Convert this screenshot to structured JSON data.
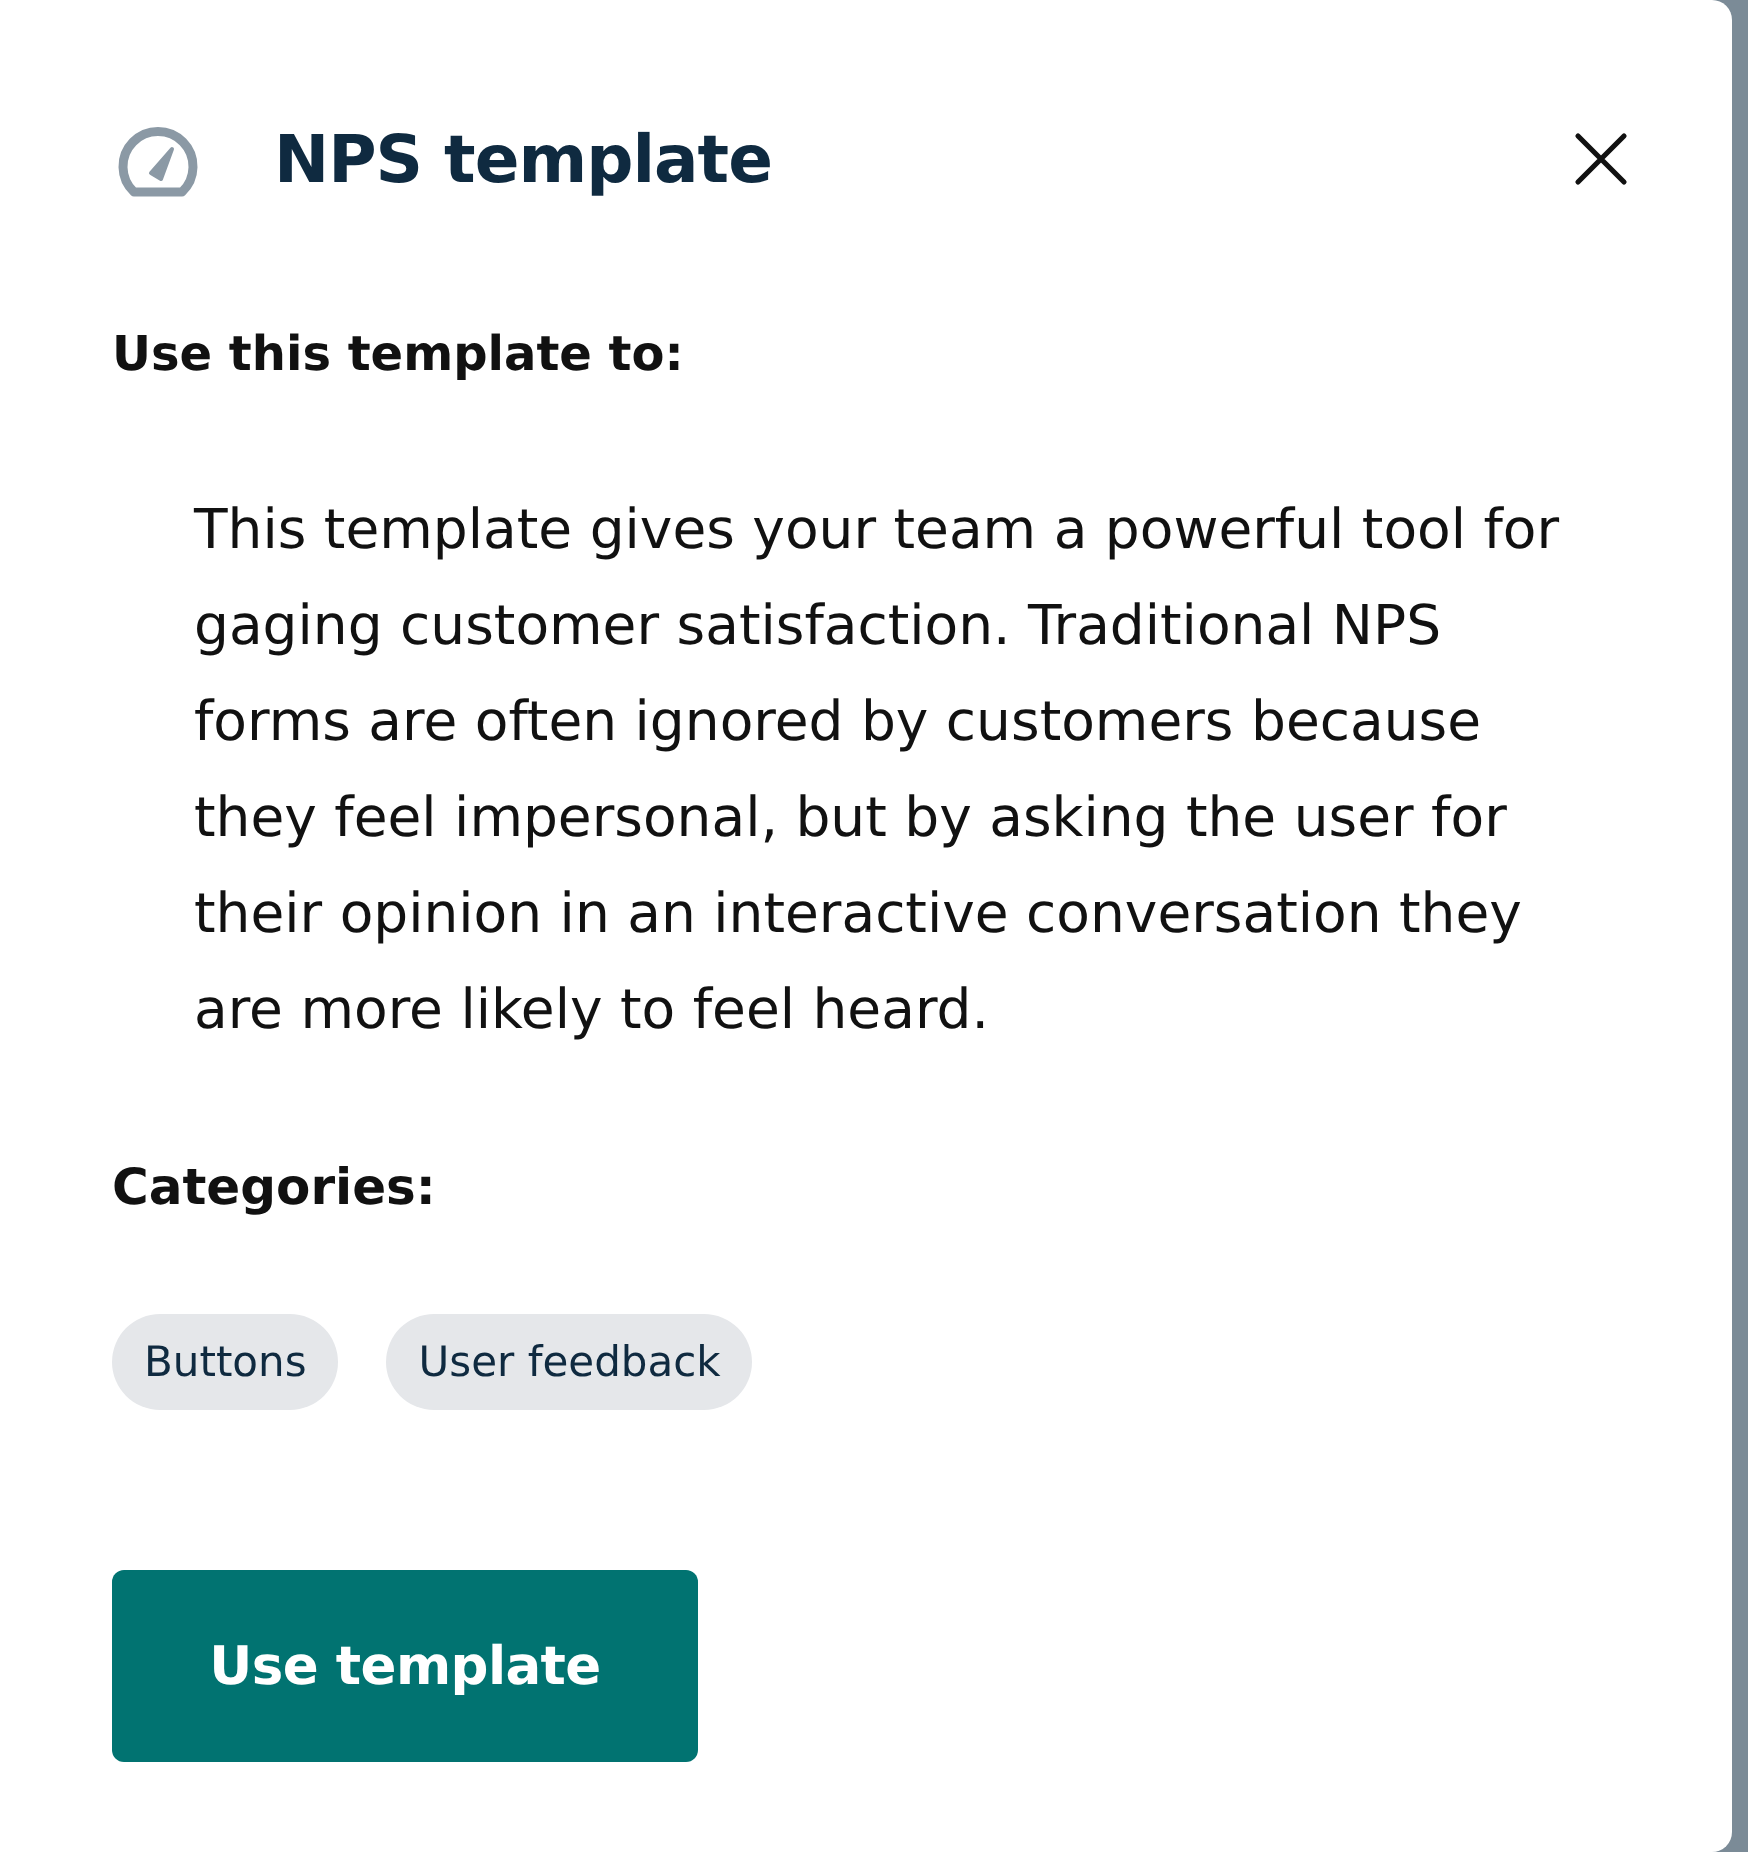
{
  "dialog": {
    "title": "NPS template",
    "intro_heading": "Use this template to:",
    "description": "This template gives your team a powerful tool for gaging customer satisfaction. Traditional NPS forms are often ignored by customers because they feel impersonal, but by asking the user for their opinion in an interactive conversation they are more likely to feel heard.",
    "categories_heading": "Categories:",
    "categories": [
      "Buttons",
      "User feedback"
    ],
    "primary_button": "Use template"
  }
}
